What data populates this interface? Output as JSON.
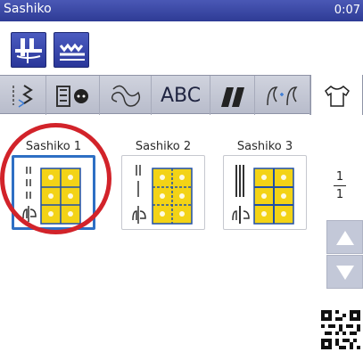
{
  "title_bar": {
    "title": "Sashiko",
    "clock": "0:07"
  },
  "toolbar": {
    "buttons": [
      {
        "icon": "needle-presser-foot-icon"
      },
      {
        "icon": "stitch-guide-icon"
      }
    ]
  },
  "tabs": [
    {
      "icon": "utility-stitch-icon"
    },
    {
      "icon": "buttonhole-icon"
    },
    {
      "icon": "decorative-stitch-icon"
    },
    {
      "label": "ABC"
    },
    {
      "icon": "satin-stitch-icon"
    },
    {
      "icon": "combined-pattern-icon"
    },
    {
      "icon": "shirt-icon",
      "active": true
    }
  ],
  "patterns": [
    {
      "label": "Sashiko 1",
      "selected": true
    },
    {
      "label": "Sashiko 2",
      "selected": false
    },
    {
      "label": "Sashiko 3",
      "selected": false
    }
  ],
  "pagination": {
    "current": "1",
    "total": "1"
  },
  "colors": {
    "accent": "#2e3b95",
    "tile": "#f3d316",
    "stitch": "#3f8cd8",
    "highlight": "#d2232a"
  }
}
